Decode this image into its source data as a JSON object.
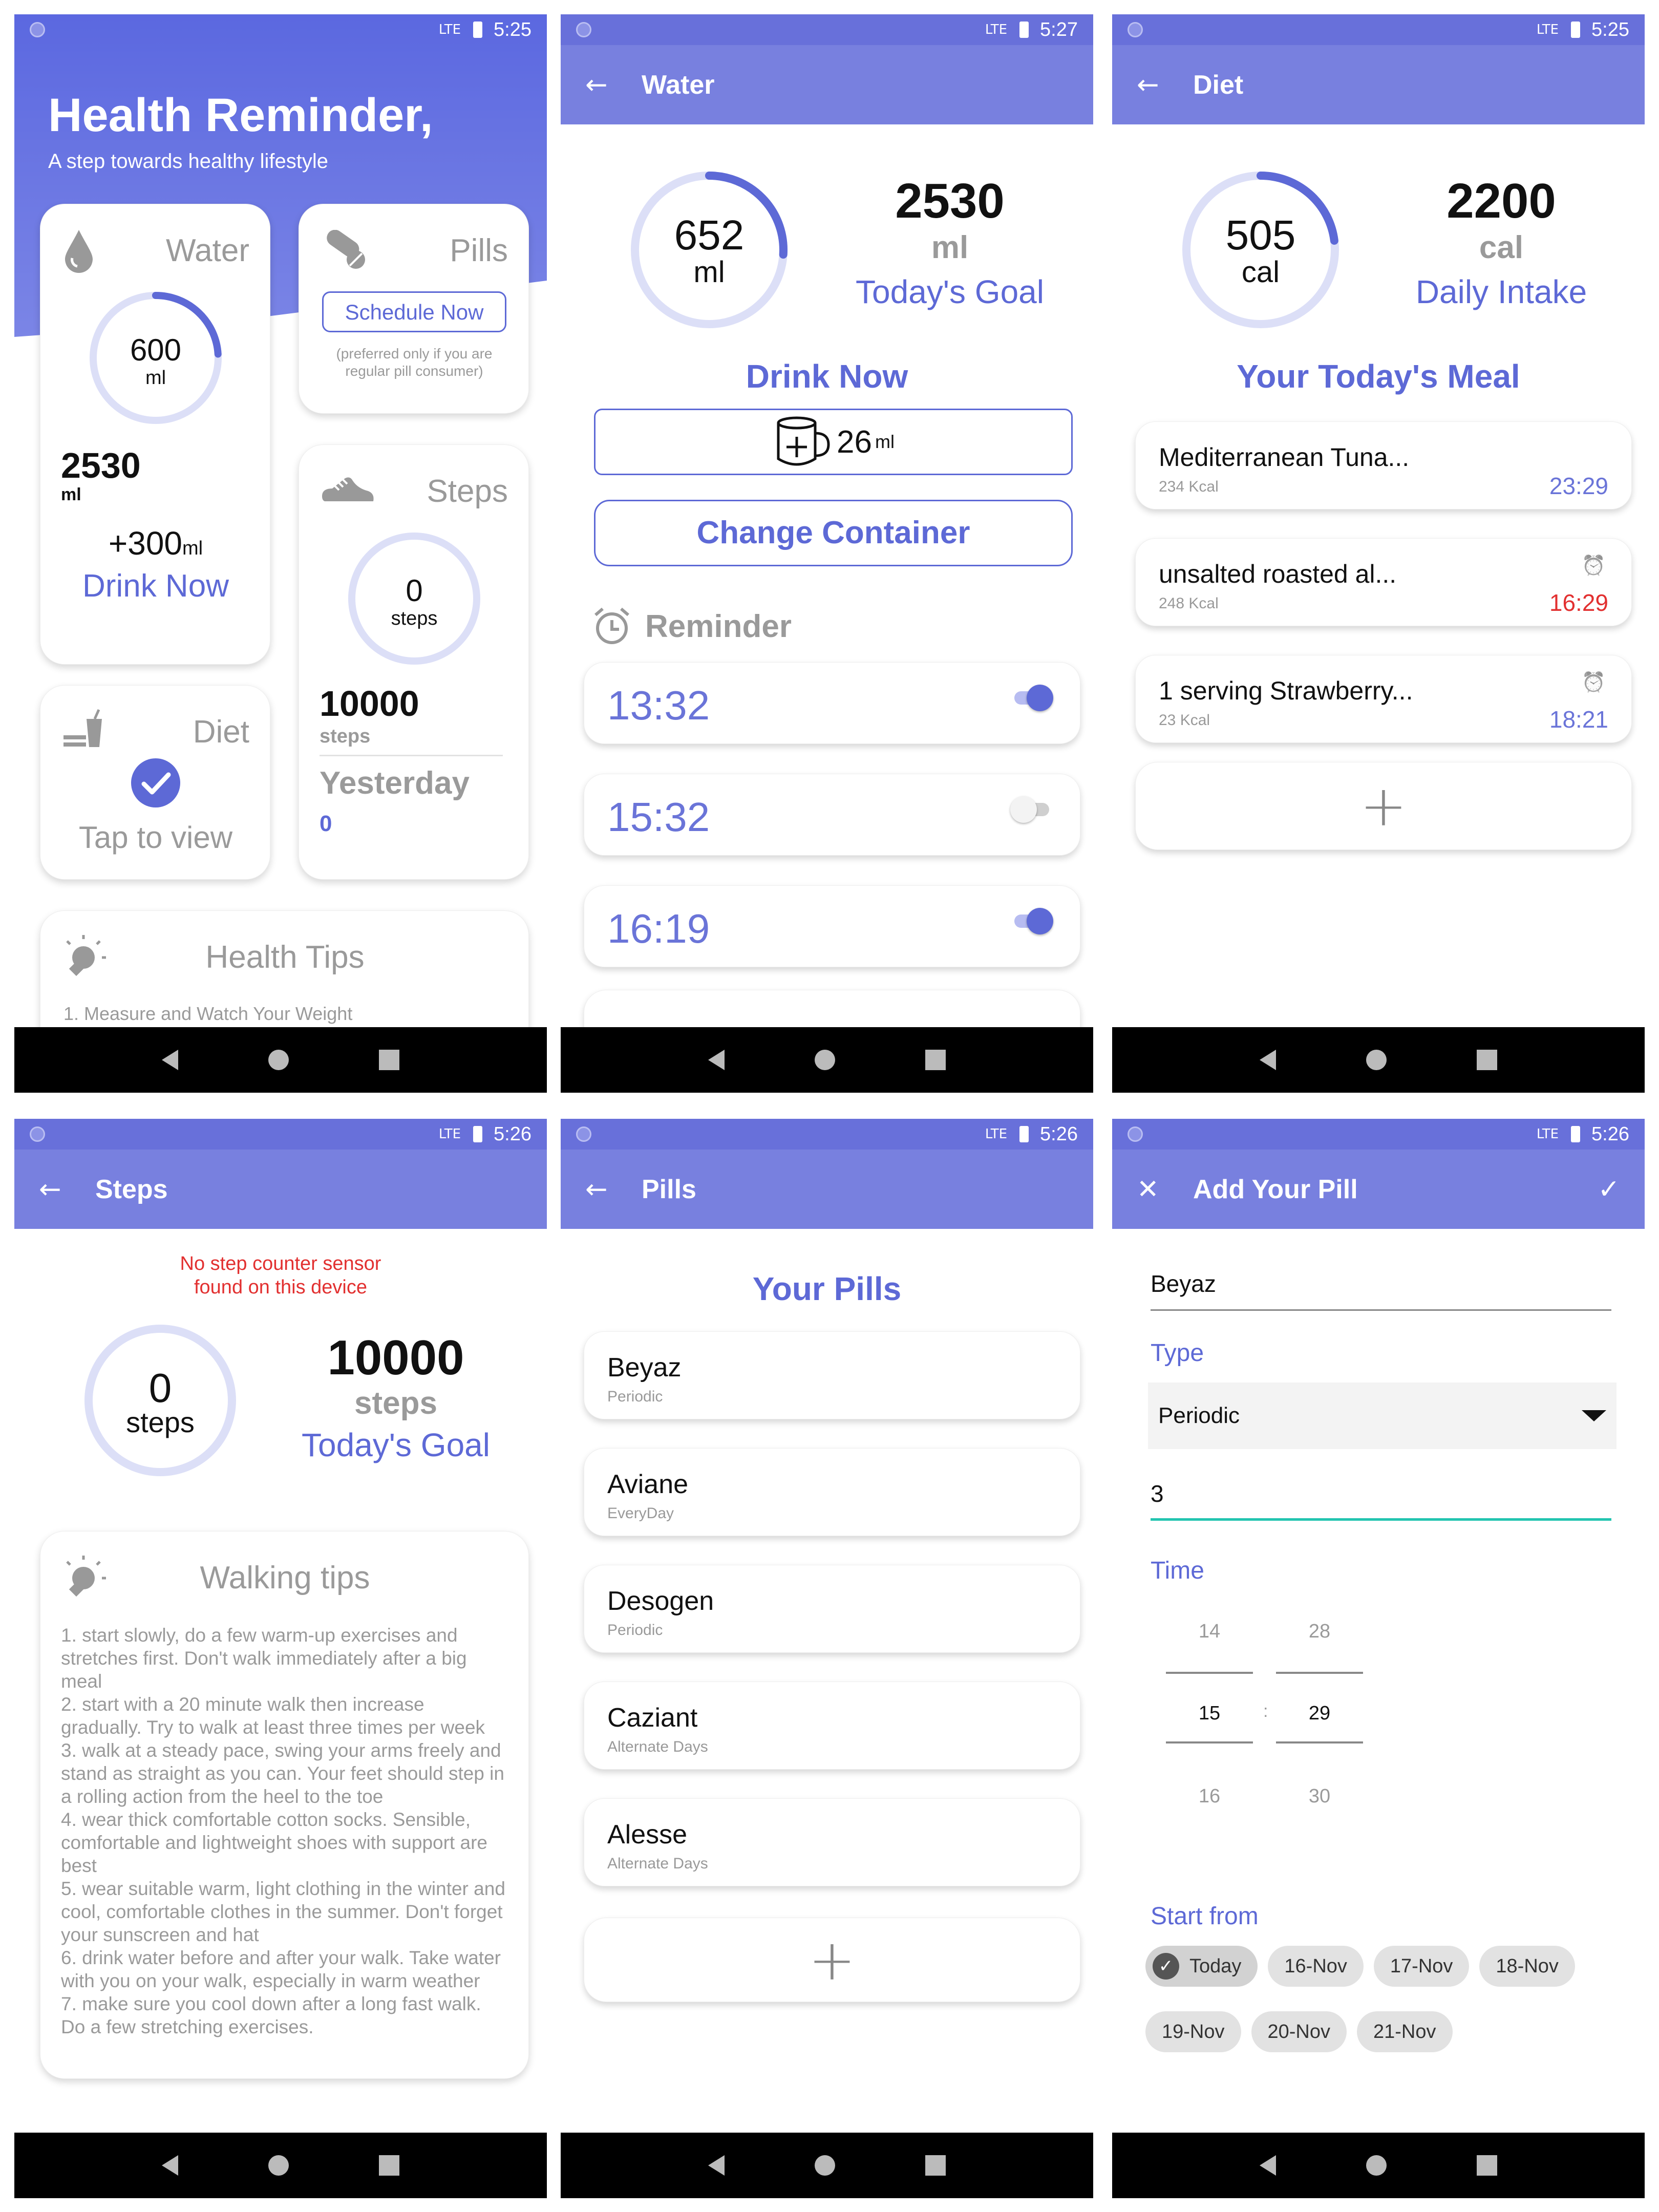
{
  "status": {
    "time_home": "5:25",
    "time_water": "5:27",
    "time_diet": "5:25",
    "time_steps": "5:26",
    "time_pills": "5:26",
    "time_add": "5:26",
    "network": "LTE"
  },
  "home": {
    "title": "Health Reminder,",
    "subtitle": "A step towards healthy lifestyle",
    "water": {
      "label": "Water",
      "ring_value": "600",
      "ring_unit": "ml",
      "total": "2530",
      "total_unit": "ml",
      "add_amount": "+300",
      "add_unit": "ml",
      "action": "Drink Now",
      "progress": 0.24
    },
    "pills": {
      "label": "Pills",
      "button": "Schedule Now",
      "note": "(preferred only if you are regular pill consumer)"
    },
    "steps": {
      "label": "Steps",
      "ring_value": "0",
      "ring_unit": "steps",
      "goal": "10000",
      "goal_unit": "steps",
      "yesterday_label": "Yesterday",
      "yesterday_value": "0"
    },
    "diet": {
      "label": "Diet",
      "action": "Tap to view"
    },
    "tips": {
      "label": "Health Tips",
      "first": "1. Measure and Watch Your Weight"
    }
  },
  "water": {
    "title": "Water",
    "ring_value": "652",
    "ring_unit": "ml",
    "goal": "2530",
    "goal_unit": "ml",
    "goal_label": "Today's Goal",
    "progress": 0.26,
    "drink_label": "Drink Now",
    "container_amount": "26",
    "container_unit": "ml",
    "change_label": "Change Container",
    "reminder_label": "Reminder",
    "reminders": [
      {
        "time": "13:32",
        "on": true
      },
      {
        "time": "15:32",
        "on": false
      },
      {
        "time": "16:19",
        "on": true
      }
    ]
  },
  "diet": {
    "title": "Diet",
    "ring_value": "505",
    "ring_unit": "cal",
    "goal": "2200",
    "goal_unit": "cal",
    "goal_label": "Daily Intake",
    "section": "Your Today's Meal",
    "progress": 0.23,
    "meals": [
      {
        "name": "Mediterranean Tuna...",
        "kcal": "234 Kcal",
        "time": "23:29",
        "alarm": false,
        "late": false
      },
      {
        "name": "unsalted roasted al...",
        "kcal": "248 Kcal",
        "time": "16:29",
        "alarm": true,
        "late": true
      },
      {
        "name": "1 serving Strawberry...",
        "kcal": "23 Kcal",
        "time": "18:21",
        "alarm": true,
        "late": false
      }
    ]
  },
  "steps": {
    "title": "Steps",
    "warning": "No step counter sensor\nfound on this device",
    "ring_value": "0",
    "ring_unit": "steps",
    "goal": "10000",
    "goal_unit": "steps",
    "goal_label": "Today's Goal",
    "tips_title": "Walking tips",
    "tips": "1. start slowly, do a few warm-up exercises and stretches first. Don't walk immediately after a big meal\n2. start with a 20 minute walk then increase gradually. Try to walk at least three times per week\n3. walk at a steady pace, swing your arms freely and stand as straight as you can. Your feet should step in a rolling action from the heel to the toe\n4. wear thick comfortable cotton socks. Sensible, comfortable and lightweight shoes with support are best\n5. wear suitable warm, light clothing in the winter and cool, comfortable clothes in the summer. Don't forget your sunscreen and hat\n6. drink water before and after your walk. Take water with you on your walk, especially in warm weather\n7. make sure you cool down after a long fast walk. Do a few stretching exercises."
  },
  "pills": {
    "title": "Pills",
    "section": "Your Pills",
    "items": [
      {
        "name": "Beyaz",
        "type": "Periodic"
      },
      {
        "name": "Aviane",
        "type": "EveryDay"
      },
      {
        "name": "Desogen",
        "type": "Periodic"
      },
      {
        "name": "Caziant",
        "type": "Alternate Days"
      },
      {
        "name": "Alesse",
        "type": "Alternate Days"
      }
    ]
  },
  "add_pill": {
    "title": "Add Your Pill",
    "name_value": "Beyaz",
    "type_label": "Type",
    "type_value": "Periodic",
    "interval_value": "3",
    "time_label": "Time",
    "hours": [
      "14",
      "15",
      "16"
    ],
    "minutes": [
      "28",
      "29",
      "30"
    ],
    "separator": ":",
    "start_label": "Start from",
    "dates": [
      "Today",
      "16-Nov",
      "17-Nov",
      "18-Nov",
      "19-Nov",
      "20-Nov",
      "21-Nov"
    ]
  },
  "colors": {
    "primary": "#6870da",
    "accent": "#5d69d6",
    "ring_track": "#dcdff7",
    "late": "#e23030",
    "teal": "#23c4b0"
  }
}
